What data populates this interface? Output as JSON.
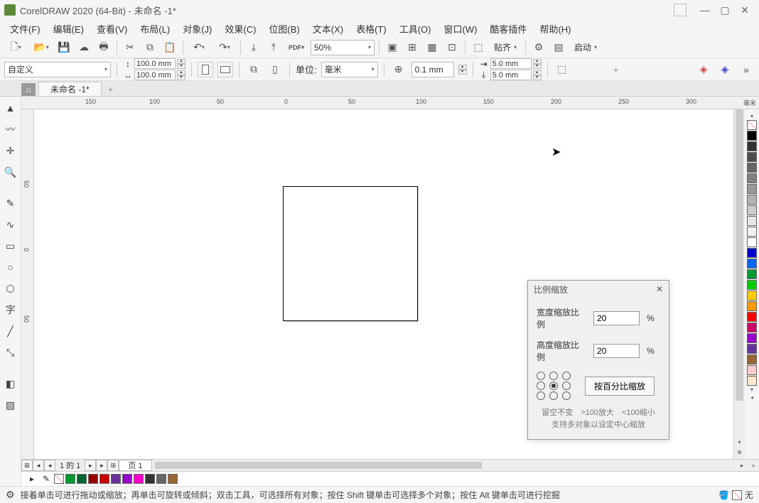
{
  "title": "CorelDRAW 2020 (64-Bit) - 未命名 -1*",
  "menu": [
    "文件(F)",
    "编辑(E)",
    "查看(V)",
    "布局(L)",
    "对象(J)",
    "效果(C)",
    "位图(B)",
    "文本(X)",
    "表格(T)",
    "工具(O)",
    "窗口(W)",
    "酷客插件",
    "帮助(H)"
  ],
  "toolbar1": {
    "zoom": "50%",
    "align_label": "贴齐",
    "launch_label": "启动"
  },
  "propbar": {
    "preset": "自定义",
    "width": "100.0 mm",
    "height": "100.0 mm",
    "unit_label": "单位:",
    "unit_value": "毫米",
    "nudge": "0.1 mm",
    "dup_x": "5.0 mm",
    "dup_y": "5.0 mm"
  },
  "tab": {
    "name": "未命名 -1*"
  },
  "hruler": {
    "ticks": [
      "150",
      "100",
      "50",
      "0",
      "50",
      "100",
      "150",
      "200",
      "250",
      "300"
    ],
    "unit": "毫米"
  },
  "vruler": {
    "ticks": [
      "50",
      "0",
      "50"
    ]
  },
  "dialog": {
    "title": "比例缩放",
    "width_label": "宽度缩放比例",
    "width_val": "20",
    "height_label": "高度缩放比例",
    "height_val": "20",
    "pct": "%",
    "button": "按百分比缩放",
    "hint1": "留空不变　>100放大　<100缩小",
    "hint2": "支持多对象以设定中心缩放"
  },
  "palette_colors": [
    "#000000",
    "#333333",
    "#4d4d4d",
    "#666666",
    "#808080",
    "#999999",
    "#b3b3b3",
    "#cccccc",
    "#e6e6e6",
    "#f2f2f2",
    "#ffffff",
    "#0000cc",
    "#0066ff",
    "#009933",
    "#00cc00",
    "#ffcc00",
    "#ff9900",
    "#ff0000",
    "#cc0066",
    "#9900cc",
    "#663399",
    "#996633",
    "#ffcccc",
    "#ffe6cc"
  ],
  "pagebar": {
    "info": "1 的 1",
    "page": "页 1"
  },
  "status_colors": [
    "#009933",
    "#006633",
    "#990000",
    "#cc0000",
    "#663399",
    "#9900cc",
    "#ff00cc",
    "#333333",
    "#666666",
    "#996633"
  ],
  "statusbar": {
    "hint": "接着单击可进行拖动或缩放；再单击可旋转或倾斜；双击工具，可选择所有对象；按住 Shift 键单击可选择多个对象；按住 Alt 键单击可进行挖掘",
    "fill": "无"
  }
}
